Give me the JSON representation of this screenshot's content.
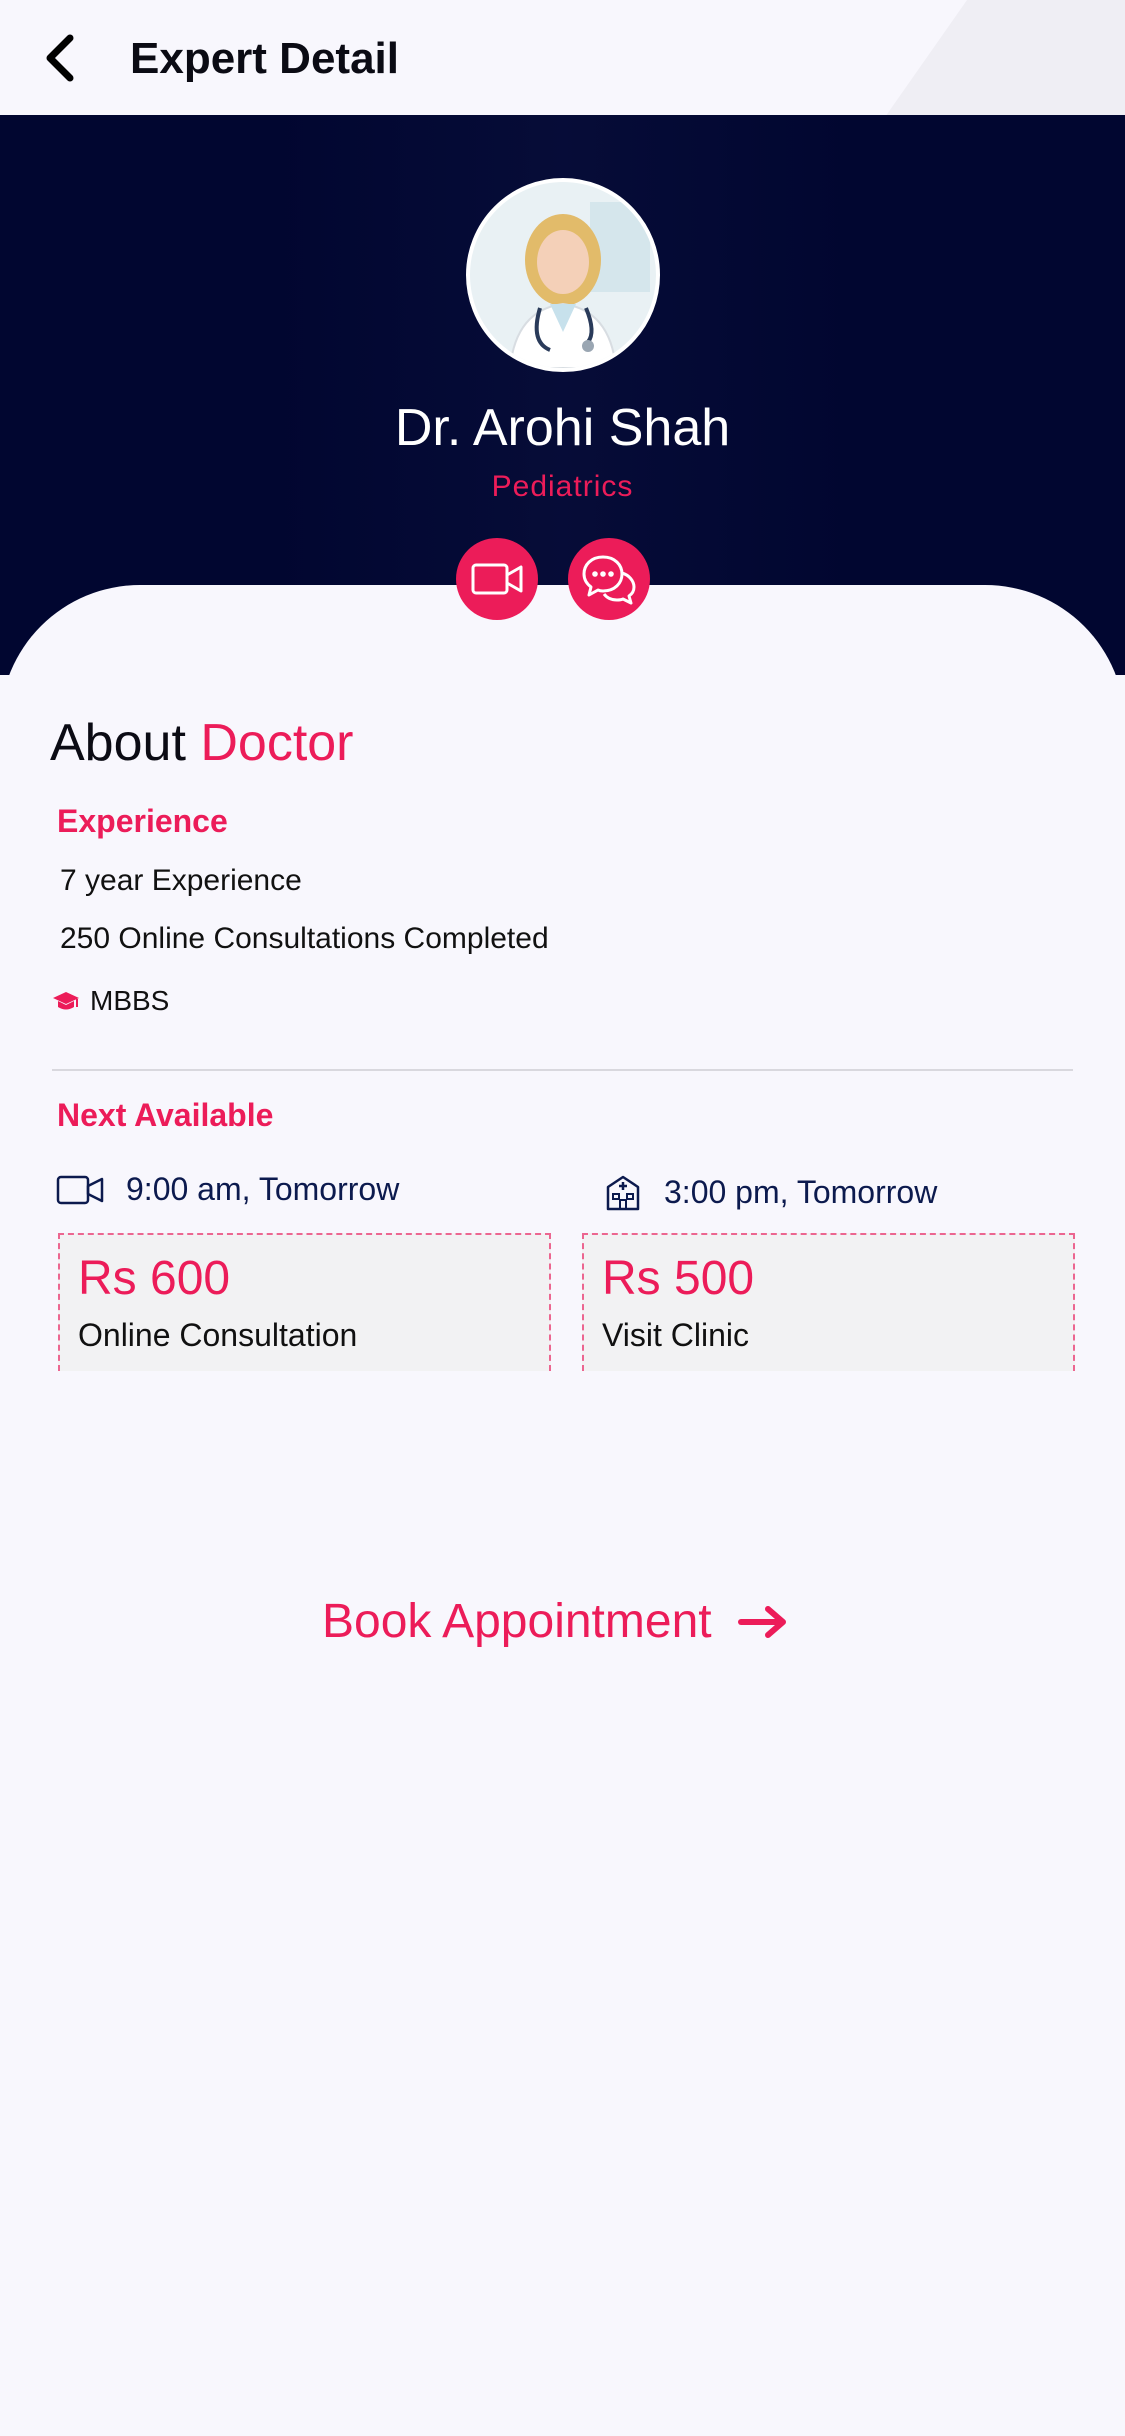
{
  "header": {
    "title": "Expert Detail"
  },
  "profile": {
    "name": "Dr. Arohi Shah",
    "specialty": "Pediatrics"
  },
  "about": {
    "heading_prefix": "About",
    "heading_accent": "Doctor",
    "experience_label": "Experience",
    "experience_years": "7 year Experience",
    "consultations": "250 Online Consultations Completed",
    "degree": "MBBS"
  },
  "availability": {
    "label": "Next Available",
    "online_slot": "9:00 am, Tomorrow",
    "clinic_slot": "3:00 pm, Tomorrow"
  },
  "pricing": {
    "online": {
      "price": "Rs 600",
      "type": "Online Consultation"
    },
    "clinic": {
      "price": "Rs 500",
      "type": "Visit Clinic"
    }
  },
  "cta": {
    "book_label": "Book Appointment"
  },
  "colors": {
    "accent": "#ec1c59",
    "navy": "#010630",
    "background": "#f8f7fd"
  }
}
